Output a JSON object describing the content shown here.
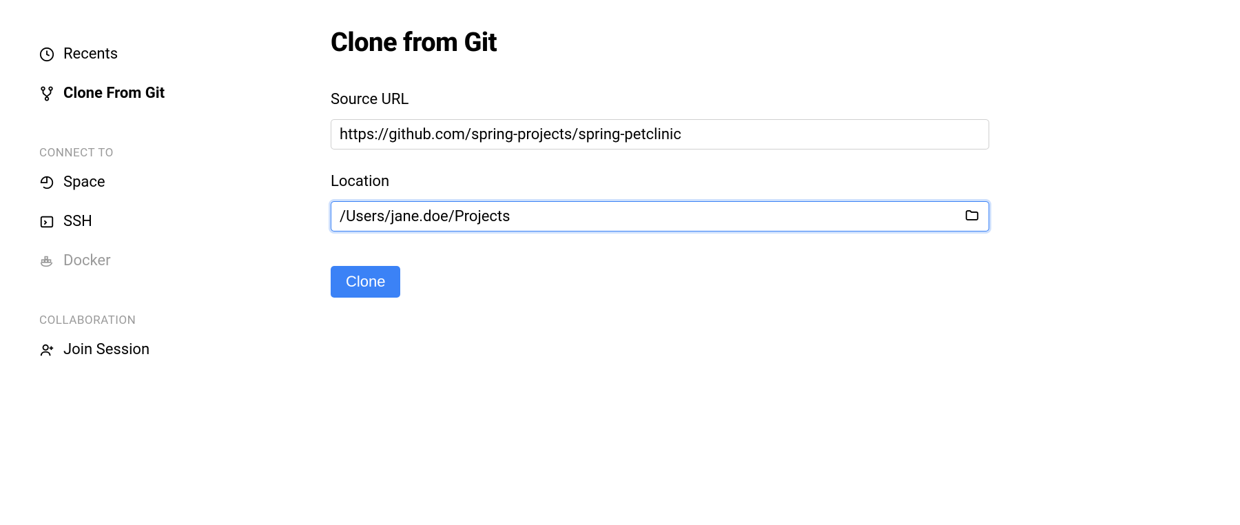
{
  "sidebar": {
    "recents_label": "Recents",
    "clone_git_label": "Clone From Git",
    "connect_header": "CONNECT TO",
    "space_label": "Space",
    "ssh_label": "SSH",
    "docker_label": "Docker",
    "collaboration_header": "COLLABORATION",
    "join_session_label": "Join Session"
  },
  "main": {
    "title": "Clone from Git",
    "source_url_label": "Source URL",
    "source_url_value": "https://github.com/spring-projects/spring-petclinic",
    "location_label": "Location",
    "location_value": "/Users/jane.doe/Projects",
    "clone_button_label": "Clone"
  }
}
